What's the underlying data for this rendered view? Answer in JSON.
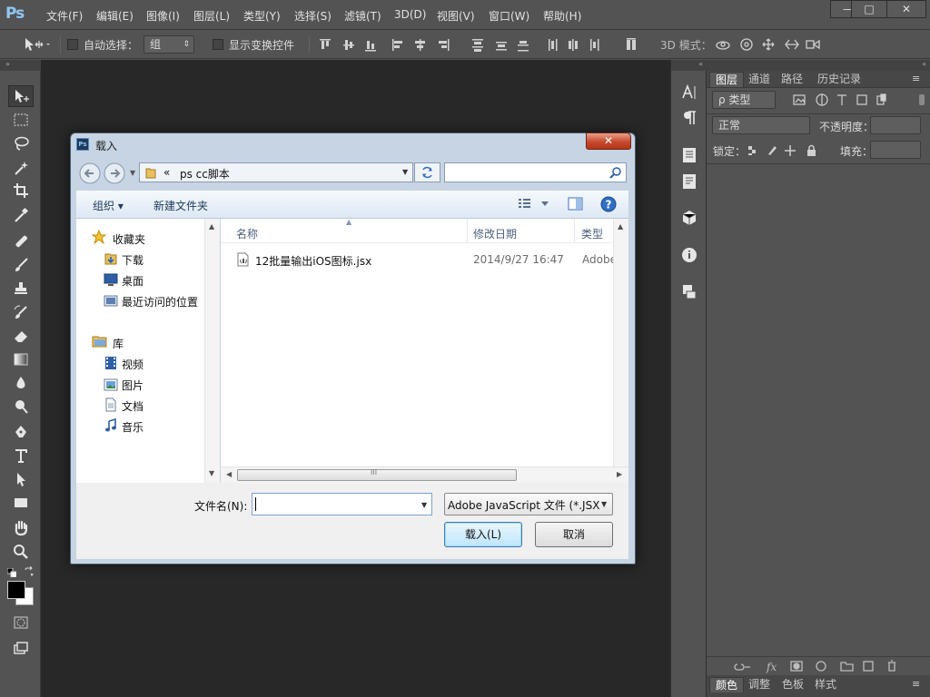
{
  "app": {
    "logo": "Ps",
    "menu": [
      "文件(F)",
      "编辑(E)",
      "图像(I)",
      "图层(L)",
      "类型(Y)",
      "选择(S)",
      "滤镜(T)",
      "3D(D)",
      "视图(V)",
      "窗口(W)",
      "帮助(H)"
    ],
    "window_buttons": {
      "minimize": "—",
      "maximize": "□",
      "close": "✕"
    }
  },
  "options_bar": {
    "auto_select_label": "自动选择：",
    "auto_select_value": "组",
    "show_transform_label": "显示变换控件",
    "mode_3d_label": "3D 模式："
  },
  "layers_panel": {
    "tabs": [
      "图层",
      "通道",
      "路径",
      "历史记录"
    ],
    "kind_filter": "ρ 类型",
    "blend_mode": "正常",
    "opacity_label": "不透明度：",
    "lock_label": "锁定：",
    "fill_label": "填充："
  },
  "swatches_panel": {
    "tabs": [
      "颜色",
      "调整",
      "色板",
      "样式"
    ]
  },
  "dialog": {
    "title": "载入",
    "path_prefix": "«",
    "path": "ps cc脚本",
    "search_placeholder": "",
    "organize_label": "组织 ▾",
    "new_folder_label": "新建文件夹",
    "nav": {
      "favorites_label": "收藏夹",
      "favorites": [
        "下载",
        "桌面",
        "最近访问的位置"
      ],
      "library_label": "库",
      "libraries": [
        "视频",
        "图片",
        "文档",
        "音乐"
      ]
    },
    "columns": {
      "name": "名称",
      "modified": "修改日期",
      "type": "类型"
    },
    "files": [
      {
        "name": "12批量输出iOS图标.jsx",
        "modified": "2014/9/27 16:47",
        "type": "Adobe"
      }
    ],
    "filename_label": "文件名(N):",
    "filename_value": "",
    "filter_value": "Adobe JavaScript 文件 (*.JSX",
    "load_button": "载入(L)",
    "cancel_button": "取消",
    "close_label": "✕",
    "scroll_grip": "III"
  },
  "colors": {
    "chrome": "#535353",
    "canvas": "#282828",
    "dialog_frame": "#c6d4e4",
    "close_red": "#c84a2e",
    "ps_blue": "#8fc7f5"
  }
}
